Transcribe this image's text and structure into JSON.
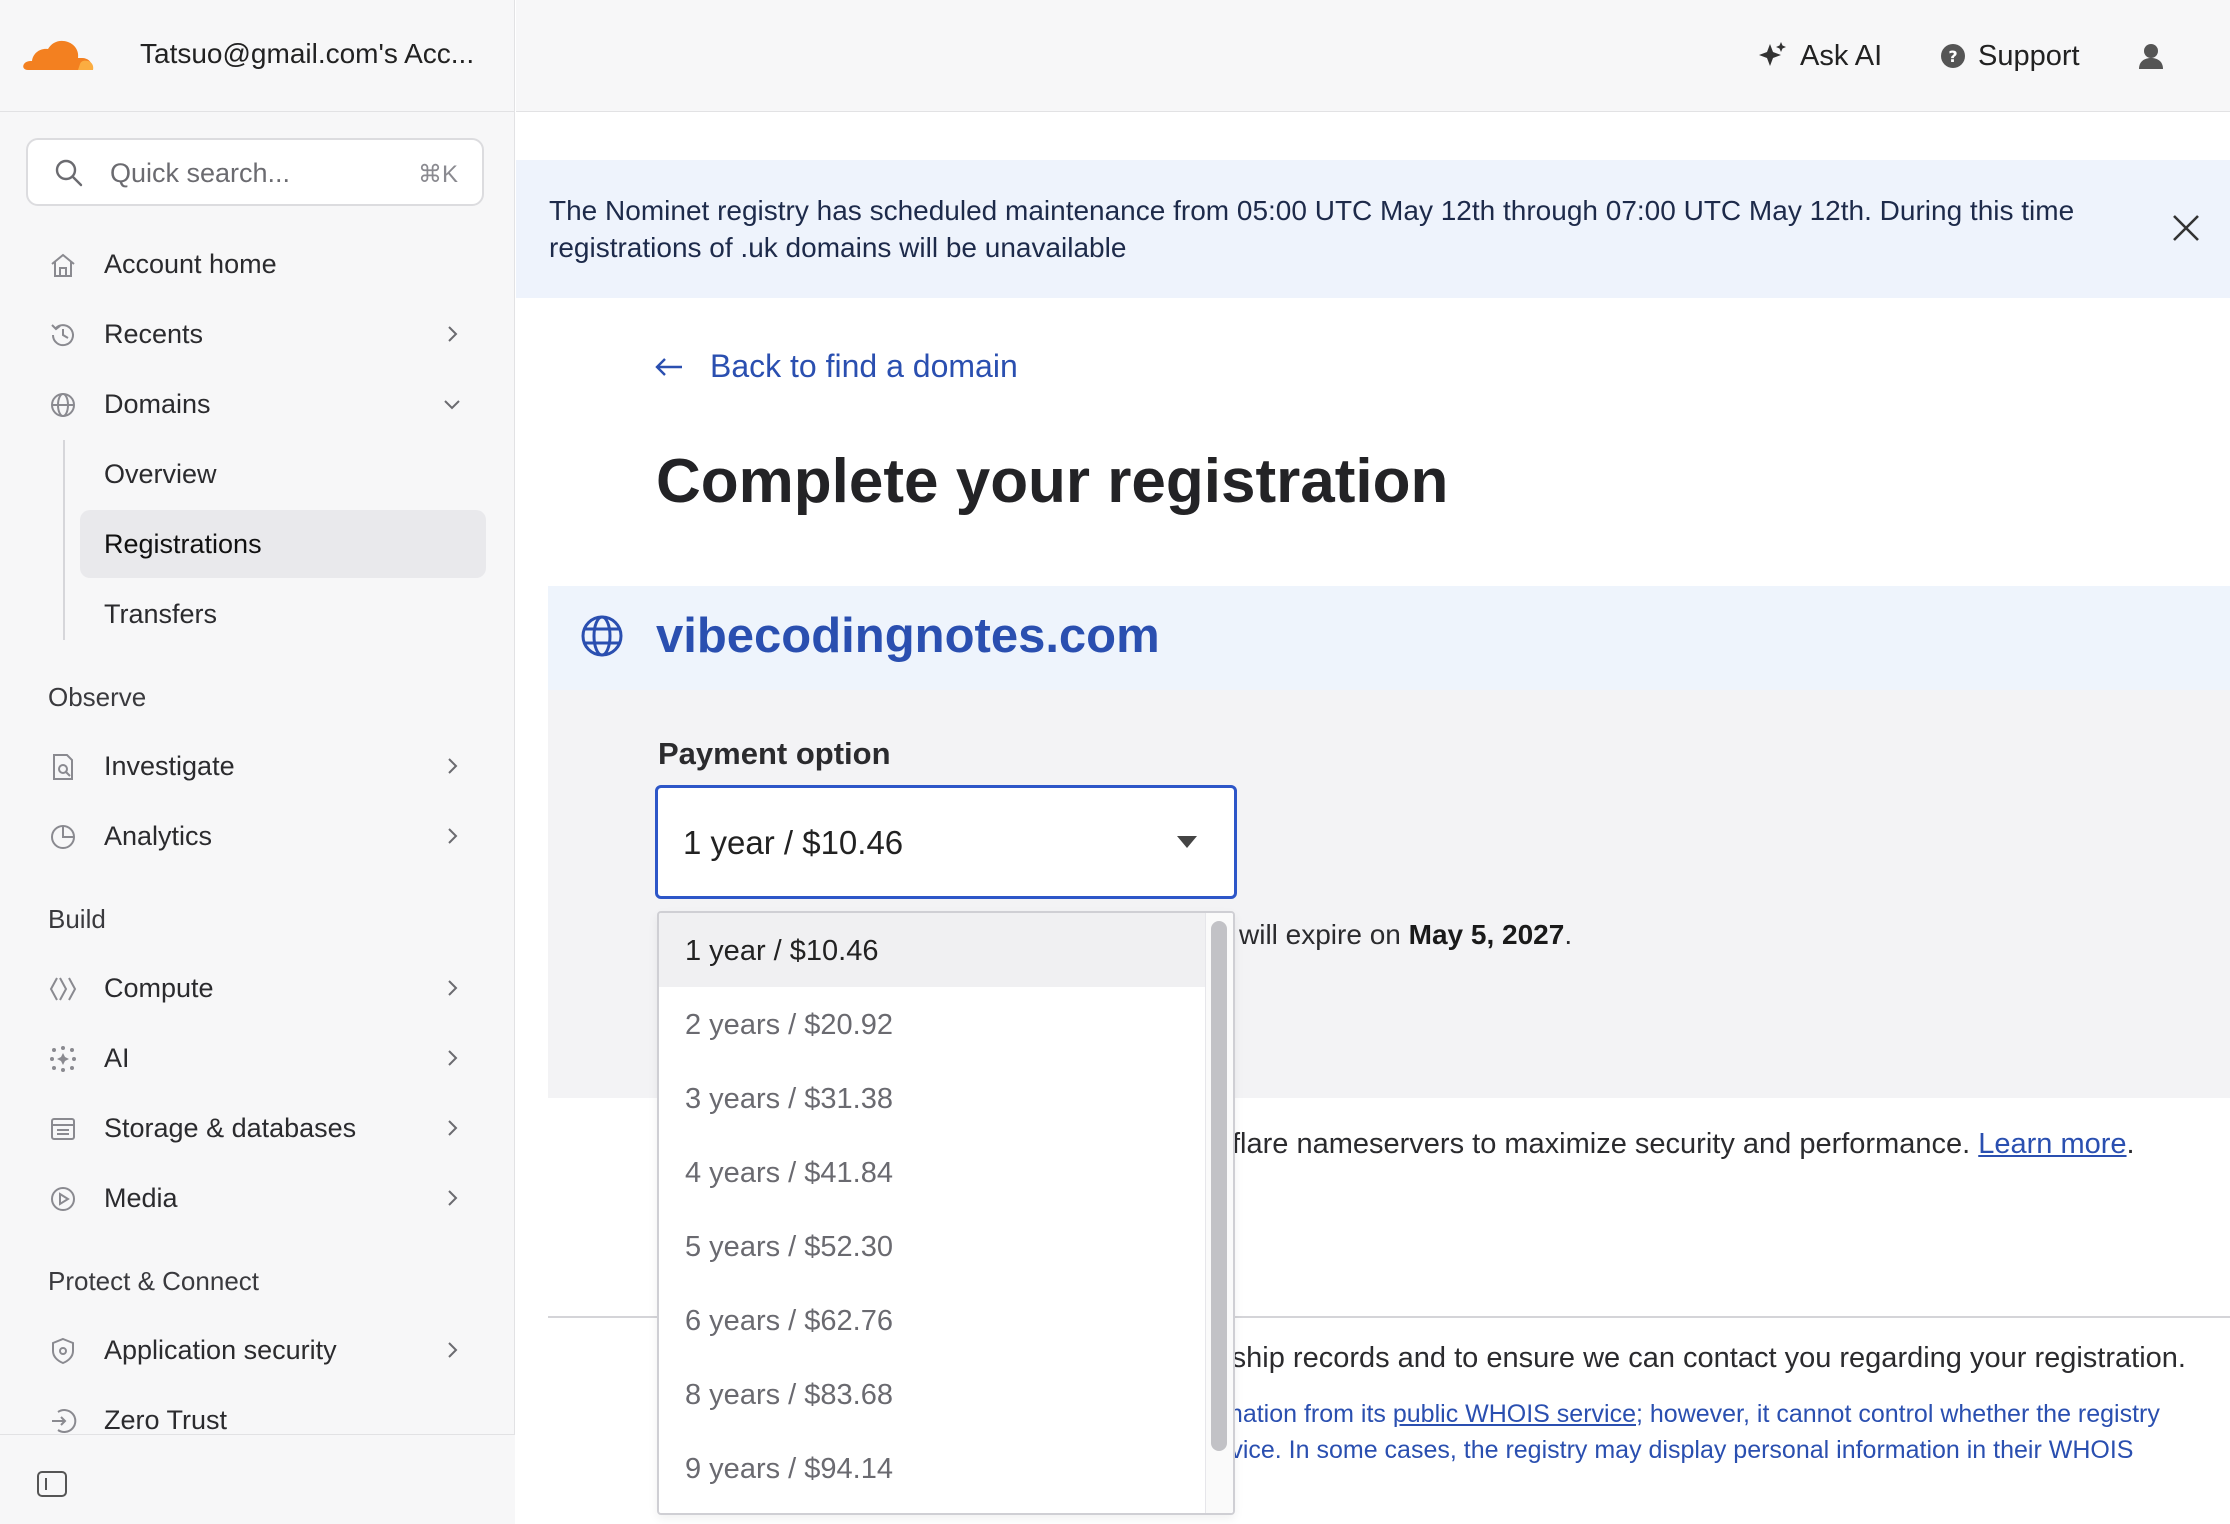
{
  "account": {
    "name": "Tatsuo@gmail.com's Acc..."
  },
  "search": {
    "placeholder": "Quick search...",
    "shortcut": "⌘K"
  },
  "sidebar": {
    "items": [
      {
        "label": "Account home",
        "icon": "home-icon"
      },
      {
        "label": "Recents",
        "icon": "history-icon"
      },
      {
        "label": "Domains",
        "icon": "globe-icon"
      },
      {
        "label": "Investigate",
        "icon": "investigate-icon"
      },
      {
        "label": "Analytics",
        "icon": "pie-chart-icon"
      },
      {
        "label": "Compute",
        "icon": "compute-icon"
      },
      {
        "label": "AI",
        "icon": "sparkle-dots-icon"
      },
      {
        "label": "Storage & databases",
        "icon": "storage-icon"
      },
      {
        "label": "Media",
        "icon": "play-circle-icon"
      },
      {
        "label": "Application security",
        "icon": "shield-icon"
      },
      {
        "label": "Zero Trust",
        "icon": "zero-trust-icon"
      }
    ],
    "domains_sub": [
      "Overview",
      "Registrations",
      "Transfers"
    ],
    "sections": [
      "Observe",
      "Build",
      "Protect & Connect"
    ]
  },
  "topbar": {
    "ask_ai": "Ask AI",
    "support": "Support"
  },
  "banner": {
    "text": "The Nominet registry has scheduled maintenance from 05:00 UTC May 12th through 07:00 UTC May 12th. During this time registrations of .uk domains will be unavailable"
  },
  "main": {
    "back_link": "Back to find a domain",
    "title": "Complete your registration",
    "domain": "vibecodingnotes.com",
    "payment_label": "Payment option",
    "selected_option": "1 year / $10.46",
    "expire_prefix": "will expire on ",
    "expire_date": "May 5, 2027",
    "expire_suffix": ".",
    "ns_text": "flare nameservers to maximize security and performance. ",
    "learn_more": "Learn more",
    "ns_suffix": ".",
    "contact_text": "rship records and to ensure we can contact you regarding your registration.",
    "whois_line1_a": "mation from its ",
    "whois_link": "public WHOIS service",
    "whois_line1_b": "; however, it cannot control whether the registry",
    "whois_line2": "rvice. In some cases, the registry may display personal information in their WHOIS"
  },
  "dropdown": {
    "options": [
      "1 year / $10.46",
      "2 years / $20.92",
      "3 years / $31.38",
      "4 years / $41.84",
      "5 years / $52.30",
      "6 years / $62.76",
      "8 years / $83.68",
      "9 years / $94.14"
    ]
  },
  "colors": {
    "accent": "#2a4fb0",
    "focus": "#2d56c8",
    "brand_orange": "#f38020",
    "banner_bg": "#eef3fc"
  }
}
